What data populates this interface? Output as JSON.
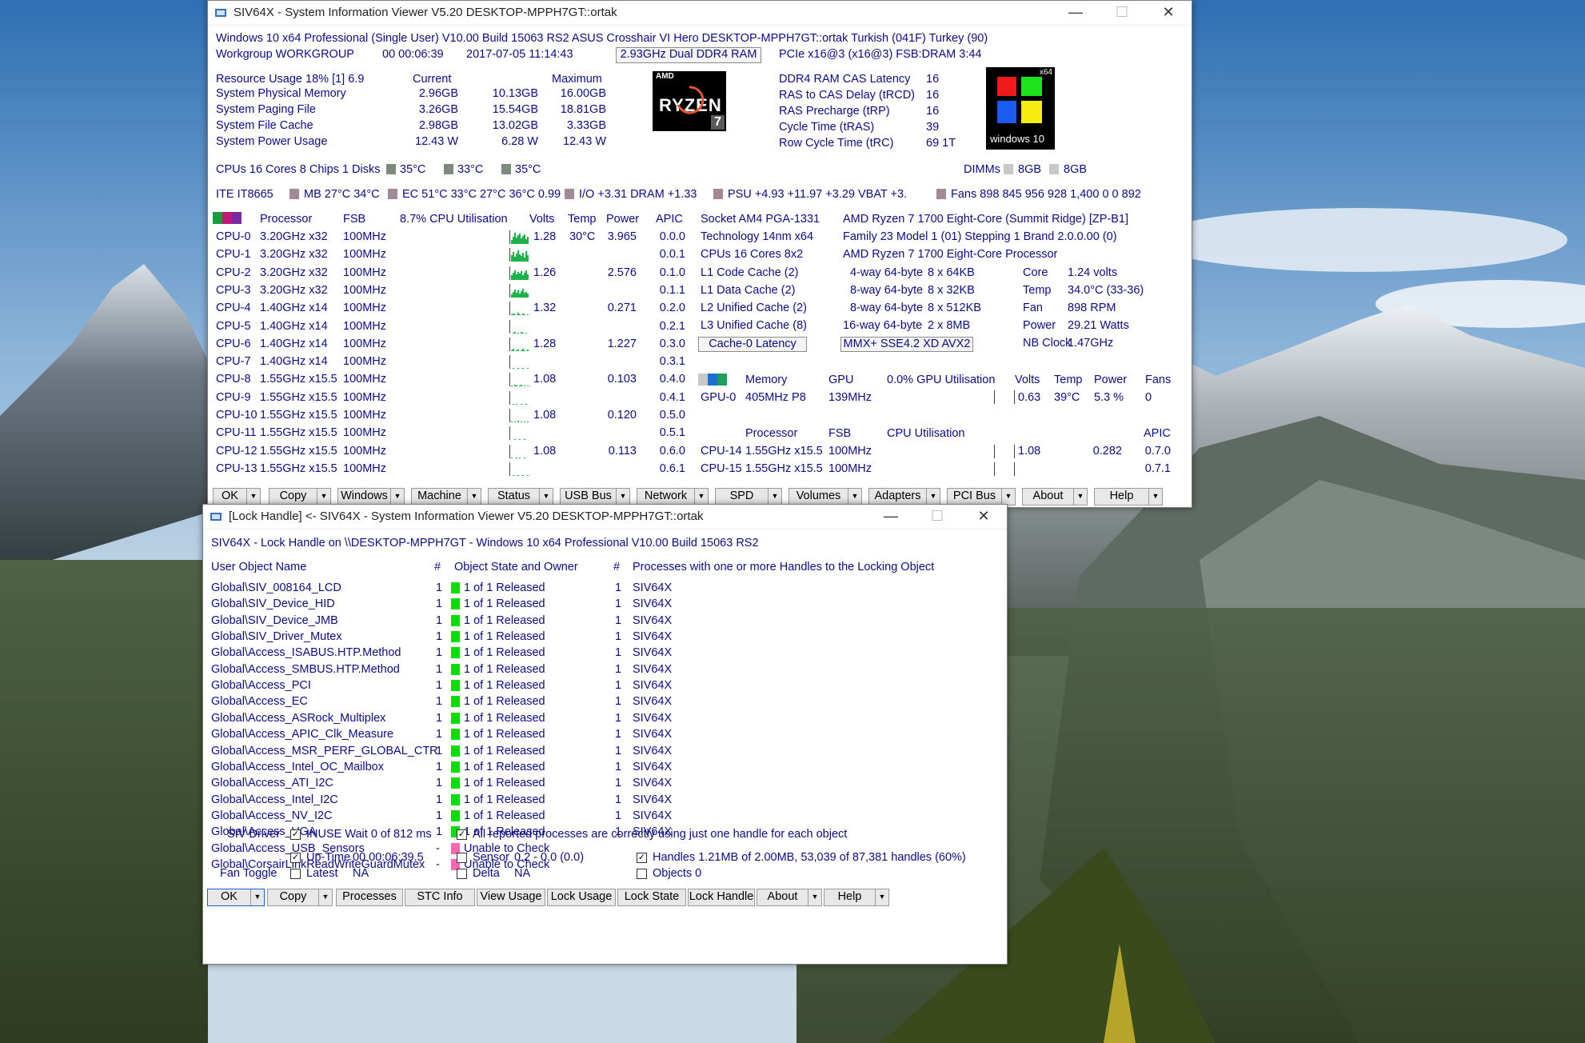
{
  "win1": {
    "title": "SIV64X - System Information Viewer V5.20 DESKTOP-MPPH7GT::ortak",
    "line1": "Windows 10 x64 Professional (Single User)   V10.00   Build 15063   RS2   ASUS Crosshair VI Hero   DESKTOP-MPPH7GT::ortak   Turkish (041F)   Turkey (90)",
    "line2_left": "Workgroup WORKGROUP",
    "line2_time": "00 00:06:39",
    "line2_date": "2017-07-05 11:14:43",
    "line2_ram": "2.93GHz Dual DDR4 RAM",
    "line2_right": "PCIe x16@3 (x16@3) FSB:DRAM 3:44",
    "res_header": "Resource Usage 18% [1] 6.9",
    "res_current": "Current",
    "res_maximum": "Maximum",
    "res_rows": [
      {
        "name": "System Physical Memory",
        "c1": "2.96GB",
        "c2": "10.13GB",
        "c3": "16.00GB"
      },
      {
        "name": "System Paging File",
        "c1": "3.26GB",
        "c2": "15.54GB",
        "c3": "18.81GB"
      },
      {
        "name": "System File Cache",
        "c1": "2.98GB",
        "c2": "13.02GB",
        "c3": "3.33GB"
      },
      {
        "name": "System Power Usage",
        "c1": "12.43 W",
        "c2": "6.28 W",
        "c3": "12.43 W"
      }
    ],
    "ryzen_brand": "AMD",
    "ryzen_text": "RYZEN",
    "ryzen_num": "7",
    "timing_rows": [
      {
        "name": "DDR4 RAM CAS Latency",
        "val": "16"
      },
      {
        "name": "RAS to CAS Delay (tRCD)",
        "val": "16"
      },
      {
        "name": "RAS Precharge (tRP)",
        "val": "16"
      },
      {
        "name": "Cycle Time (tRAS)",
        "val": "39"
      },
      {
        "name": "Row Cycle Time (tRC)",
        "val": "69 1T"
      }
    ],
    "win_logo_x64": "x64",
    "win_logo_text": "windows 10",
    "cpus_line": "CPUs 16 Cores 8 Chips 1 Disks",
    "disk_temps": [
      "35°C",
      "33°C",
      "35°C"
    ],
    "dimms_label": "DIMMs",
    "dimms": [
      "8GB",
      "8GB"
    ],
    "sensor_ite": "ITE IT8665",
    "sensor_mb": "MB 27°C 34°C",
    "sensor_ec": "EC 51°C 33°C 27°C 36°C 0.99",
    "sensor_io": "I/O +3.31 DRAM +1.33",
    "sensor_psu": "PSU +4.93 +11.97 +3.29 VBAT +3.",
    "sensor_fans": "Fans 898 845 956 928 1,400 0 0 892",
    "cpu_header": {
      "proc": "Processor",
      "fsb": "FSB",
      "util": "8.7% CPU Utilisation",
      "volts": "Volts",
      "temp": "Temp",
      "power": "Power",
      "apic": "APIC"
    },
    "cpu_rows": [
      {
        "id": "CPU-0",
        "proc": "3.20GHz x32",
        "fsb": "100MHz",
        "volts": "1.28",
        "temp": "30°C",
        "power": "3.965",
        "apic": "0.0.0",
        "load": [
          5,
          9,
          14,
          8,
          11,
          13,
          7,
          10,
          12,
          6,
          9
        ]
      },
      {
        "id": "CPU-1",
        "proc": "3.20GHz x32",
        "fsb": "100MHz",
        "volts": "",
        "temp": "",
        "power": "",
        "apic": "0.0.1",
        "load": [
          8,
          12,
          6,
          10,
          14,
          9,
          7,
          11,
          5,
          13,
          8
        ]
      },
      {
        "id": "CPU-2",
        "proc": "3.20GHz x32",
        "fsb": "100MHz",
        "volts": "1.26",
        "temp": "",
        "power": "2.576",
        "apic": "0.1.0",
        "load": [
          6,
          9,
          12,
          7,
          10,
          8,
          11,
          6,
          9,
          12,
          7
        ]
      },
      {
        "id": "CPU-3",
        "proc": "3.20GHz x32",
        "fsb": "100MHz",
        "volts": "",
        "temp": "",
        "power": "",
        "apic": "0.1.1",
        "load": [
          4,
          7,
          10,
          6,
          9,
          5,
          8,
          11,
          6,
          7,
          5
        ]
      },
      {
        "id": "CPU-4",
        "proc": "1.40GHz x14",
        "fsb": "100MHz",
        "volts": "1.32",
        "temp": "",
        "power": "0.271",
        "apic": "0.2.0",
        "load": [
          1,
          2,
          1,
          0,
          3,
          1,
          0,
          2,
          1,
          0,
          1
        ]
      },
      {
        "id": "CPU-5",
        "proc": "1.40GHz x14",
        "fsb": "100MHz",
        "volts": "",
        "temp": "",
        "power": "",
        "apic": "0.2.1",
        "load": [
          0,
          1,
          2,
          0,
          1,
          0,
          2,
          1,
          0,
          1,
          0
        ]
      },
      {
        "id": "CPU-6",
        "proc": "1.40GHz x14",
        "fsb": "100MHz",
        "volts": "1.28",
        "temp": "",
        "power": "1.227",
        "apic": "0.3.0",
        "load": [
          1,
          3,
          0,
          1,
          2,
          0,
          1,
          3,
          1,
          0,
          2
        ]
      },
      {
        "id": "CPU-7",
        "proc": "1.40GHz x14",
        "fsb": "100MHz",
        "volts": "",
        "temp": "",
        "power": "",
        "apic": "0.3.1",
        "load": [
          0,
          1,
          0,
          0,
          1,
          0,
          0,
          1,
          0,
          0,
          1
        ]
      },
      {
        "id": "CPU-8",
        "proc": "1.55GHz x15.5",
        "fsb": "100MHz",
        "volts": "1.08",
        "temp": "",
        "power": "0.103",
        "apic": "0.4.0",
        "load": [
          1,
          0,
          2,
          1,
          0,
          1,
          2,
          0,
          1,
          0,
          1
        ]
      },
      {
        "id": "CPU-9",
        "proc": "1.55GHz x15.5",
        "fsb": "100MHz",
        "volts": "",
        "temp": "",
        "power": "",
        "apic": "0.4.1",
        "load": [
          0,
          1,
          0,
          1,
          0,
          0,
          1,
          0,
          0,
          1,
          0
        ]
      },
      {
        "id": "CPU-10",
        "proc": "1.55GHz x15.5",
        "fsb": "100MHz",
        "volts": "1.08",
        "temp": "",
        "power": "0.120",
        "apic": "0.5.0",
        "load": [
          1,
          0,
          1,
          0,
          2,
          0,
          1,
          0,
          1,
          0,
          1
        ]
      },
      {
        "id": "CPU-11",
        "proc": "1.55GHz x15.5",
        "fsb": "100MHz",
        "volts": "",
        "temp": "",
        "power": "",
        "apic": "0.5.1",
        "load": [
          0,
          0,
          1,
          0,
          0,
          1,
          0,
          0,
          1,
          0,
          0
        ]
      },
      {
        "id": "CPU-12",
        "proc": "1.55GHz x15.5",
        "fsb": "100MHz",
        "volts": "1.08",
        "temp": "",
        "power": "0.113",
        "apic": "0.6.0",
        "load": [
          1,
          0,
          0,
          1,
          0,
          1,
          0,
          0,
          1,
          0,
          0
        ]
      },
      {
        "id": "CPU-13",
        "proc": "1.55GHz x15.5",
        "fsb": "100MHz",
        "volts": "",
        "temp": "",
        "power": "",
        "apic": "0.6.1",
        "load": [
          0,
          1,
          0,
          0,
          1,
          0,
          0,
          1,
          0,
          0,
          1
        ]
      }
    ],
    "socket": "Socket AM4 PGA-1331",
    "cpu_name": "AMD Ryzen 7 1700 Eight-Core (Summit Ridge) [ZP-B1]",
    "technology": "Technology 14nm  x64",
    "family": "Family 23  Model 1 (01)  Stepping 1  Brand 2.0.0.00 (0)",
    "cpus_cores": "CPUs 16 Cores 8x2",
    "cpu_name2": "AMD Ryzen 7 1700 Eight-Core Processor",
    "caches": [
      {
        "name": "L1 Code Cache (2)",
        "assoc": "4-way 64-byte",
        "size": "8 x 64KB"
      },
      {
        "name": "L1 Data Cache (2)",
        "assoc": "8-way 64-byte",
        "size": "8 x 32KB"
      },
      {
        "name": "L2 Unified Cache (2)",
        "assoc": "8-way 64-byte",
        "size": "8 x 512KB"
      },
      {
        "name": "L3 Unified Cache (8)",
        "assoc": "16-way 64-byte",
        "size": "2 x 8MB"
      }
    ],
    "core_stats": [
      {
        "name": "Core",
        "val": "1.24 volts"
      },
      {
        "name": "Temp",
        "val": "34.0°C (33-36)"
      },
      {
        "name": "Fan",
        "val": "898 RPM"
      },
      {
        "name": "Power",
        "val": "29.21 Watts"
      },
      {
        "name": "NB Clock",
        "val": "1.47GHz"
      }
    ],
    "cache_latency": "Cache-0 Latency",
    "isa": "MMX+ SSE4.2 XD AVX2",
    "gpu_header": {
      "memory": "Memory",
      "gpu": "GPU",
      "util": "0.0% GPU Utilisation",
      "volts": "Volts",
      "temp": "Temp",
      "power": "Power",
      "fans": "Fans"
    },
    "gpu_row": {
      "id": "GPU-0",
      "memory": "405MHz P8",
      "gpu": "139MHz",
      "volts": "0.63",
      "temp": "39°C",
      "power": "5.3 %",
      "fans": "0"
    },
    "cpu2_header": {
      "proc": "Processor",
      "fsb": "FSB",
      "util": "CPU Utilisation",
      "apic": "APIC"
    },
    "cpu2_rows": [
      {
        "id": "CPU-14",
        "proc": "1.55GHz x15.5",
        "fsb": "100MHz",
        "volts": "1.08",
        "power": "0.282",
        "apic": "0.7.0"
      },
      {
        "id": "CPU-15",
        "proc": "1.55GHz x15.5",
        "fsb": "100MHz",
        "volts": "",
        "power": "",
        "apic": "0.7.1"
      }
    ],
    "buttons": [
      "OK",
      "Copy",
      "Windows",
      "Machine",
      "Status",
      "USB Bus",
      "Network",
      "SPD",
      "Volumes",
      "Adapters",
      "PCI Bus",
      "About",
      "Help"
    ]
  },
  "win2": {
    "title": "[Lock Handle] <- SIV64X - System Information Viewer V5.20 DESKTOP-MPPH7GT::ortak",
    "subtitle": "SIV64X - Lock Handle on \\\\DESKTOP-MPPH7GT - Windows 10 x64 Professional  V10.00  Build 15063  RS2",
    "col_name": "User Object Name",
    "col_hash1": "#",
    "col_state": "Object State and Owner",
    "col_hash2": "#",
    "col_procs": "Processes with one or more Handles to the Locking Object",
    "rows": [
      {
        "name": "Global\\SIV_008164_LCD",
        "n": "1",
        "state": "1 of 1 Released",
        "ok": true,
        "n2": "1",
        "proc": "SIV64X"
      },
      {
        "name": "Global\\SIV_Device_HID",
        "n": "1",
        "state": "1 of 1 Released",
        "ok": true,
        "n2": "1",
        "proc": "SIV64X"
      },
      {
        "name": "Global\\SIV_Device_JMB",
        "n": "1",
        "state": "1 of 1 Released",
        "ok": true,
        "n2": "1",
        "proc": "SIV64X"
      },
      {
        "name": "Global\\SIV_Driver_Mutex",
        "n": "1",
        "state": "1 of 1 Released",
        "ok": true,
        "n2": "1",
        "proc": "SIV64X"
      },
      {
        "name": "Global\\Access_ISABUS.HTP.Method",
        "n": "1",
        "state": "1 of 1 Released",
        "ok": true,
        "n2": "1",
        "proc": "SIV64X"
      },
      {
        "name": "Global\\Access_SMBUS.HTP.Method",
        "n": "1",
        "state": "1 of 1 Released",
        "ok": true,
        "n2": "1",
        "proc": "SIV64X"
      },
      {
        "name": "Global\\Access_PCI",
        "n": "1",
        "state": "1 of 1 Released",
        "ok": true,
        "n2": "1",
        "proc": "SIV64X"
      },
      {
        "name": "Global\\Access_EC",
        "n": "1",
        "state": "1 of 1 Released",
        "ok": true,
        "n2": "1",
        "proc": "SIV64X"
      },
      {
        "name": "Global\\Access_ASRock_Multiplex",
        "n": "1",
        "state": "1 of 1 Released",
        "ok": true,
        "n2": "1",
        "proc": "SIV64X"
      },
      {
        "name": "Global\\Access_APIC_Clk_Measure",
        "n": "1",
        "state": "1 of 1 Released",
        "ok": true,
        "n2": "1",
        "proc": "SIV64X"
      },
      {
        "name": "Global\\Access_MSR_PERF_GLOBAL_CTR",
        "n": "1",
        "state": "1 of 1 Released",
        "ok": true,
        "n2": "1",
        "proc": "SIV64X"
      },
      {
        "name": "Global\\Access_Intel_OC_Mailbox",
        "n": "1",
        "state": "1 of 1 Released",
        "ok": true,
        "n2": "1",
        "proc": "SIV64X"
      },
      {
        "name": "Global\\Access_ATI_I2C",
        "n": "1",
        "state": "1 of 1 Released",
        "ok": true,
        "n2": "1",
        "proc": "SIV64X"
      },
      {
        "name": "Global\\Access_Intel_I2C",
        "n": "1",
        "state": "1 of 1 Released",
        "ok": true,
        "n2": "1",
        "proc": "SIV64X"
      },
      {
        "name": "Global\\Access_NV_I2C",
        "n": "1",
        "state": "1 of 1 Released",
        "ok": true,
        "n2": "1",
        "proc": "SIV64X"
      },
      {
        "name": "Global\\Access_VGA",
        "n": "1",
        "state": "1 of 1 Released",
        "ok": true,
        "n2": "1",
        "proc": "SIV64X"
      },
      {
        "name": "Global\\Access_USB_Sensors",
        "n": "-",
        "state": "Unable to Check",
        "ok": false,
        "n2": "",
        "proc": ""
      },
      {
        "name": "Global\\CorsairLinkReadWriteGuardMutex",
        "n": "-",
        "state": "Unable to Check",
        "ok": false,
        "n2": "",
        "proc": ""
      }
    ],
    "siv_driver": "SIV Driver",
    "inuse": "INUSE Wait 0 of 812 ms",
    "all_reported": "All reported processes are correctly using just one handle for each object",
    "uptime_label": "Up-Time",
    "uptime_val": "00 00:06:39.5",
    "sensor_label": "Sensor",
    "sensor_val": "0.2 - 0.0 (0.0)",
    "handles": "Handles 1.21MB of 2.00MB, 53,039 of 87,381 handles (60%)",
    "fan_toggle": "Fan Toggle",
    "latest_label": "Latest",
    "latest_val": "NA",
    "delta_label": "Delta",
    "delta_val": "NA",
    "objects": "Objects 0",
    "buttons": [
      "OK",
      "Copy",
      "Processes",
      "STC Info",
      "View Usage",
      "Lock Usage",
      "Lock State",
      "Lock Handle",
      "About",
      "Help"
    ]
  },
  "colors": {
    "navy": "#0c0c82",
    "green": "#00e000",
    "pink": "#ff66b0"
  }
}
